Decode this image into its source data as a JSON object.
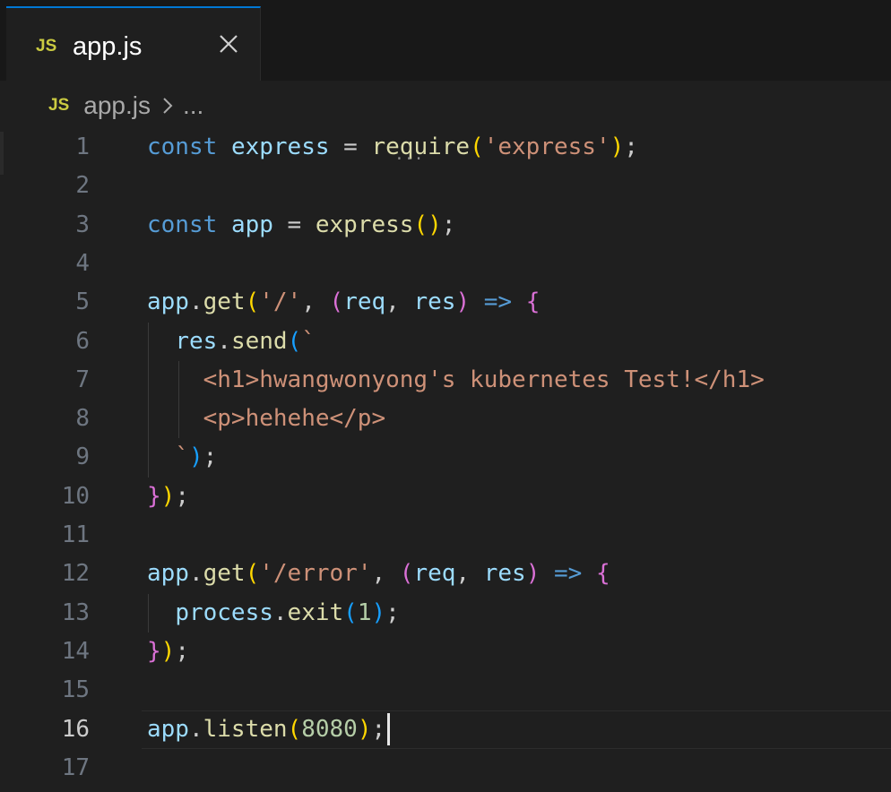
{
  "tab": {
    "badge": "JS",
    "title": "app.js"
  },
  "breadcrumb": {
    "badge": "JS",
    "file": "app.js",
    "more": "..."
  },
  "active_line": 16,
  "lines": [
    {
      "n": "1",
      "tokens": [
        [
          "k",
          "const"
        ],
        [
          "p",
          " "
        ],
        [
          "v",
          "express"
        ],
        [
          "p",
          " = "
        ],
        [
          "f",
          "require"
        ],
        [
          "b1",
          "("
        ],
        [
          "s",
          "'express'"
        ],
        [
          "b1",
          ")"
        ],
        [
          "p",
          ";"
        ]
      ]
    },
    {
      "n": "2",
      "tokens": []
    },
    {
      "n": "3",
      "tokens": [
        [
          "k",
          "const"
        ],
        [
          "p",
          " "
        ],
        [
          "v",
          "app"
        ],
        [
          "p",
          " = "
        ],
        [
          "f",
          "express"
        ],
        [
          "b1",
          "()"
        ],
        [
          "p",
          ";"
        ]
      ]
    },
    {
      "n": "4",
      "tokens": []
    },
    {
      "n": "5",
      "tokens": [
        [
          "v",
          "app"
        ],
        [
          "p",
          "."
        ],
        [
          "f",
          "get"
        ],
        [
          "b1",
          "("
        ],
        [
          "s",
          "'/'"
        ],
        [
          "p",
          ", "
        ],
        [
          "b2",
          "("
        ],
        [
          "pm",
          "req"
        ],
        [
          "p",
          ", "
        ],
        [
          "pm",
          "res"
        ],
        [
          "b2",
          ")"
        ],
        [
          "p",
          " "
        ],
        [
          "a",
          "=>"
        ],
        [
          "p",
          " "
        ],
        [
          "b2",
          "{"
        ]
      ]
    },
    {
      "n": "6",
      "tokens": [
        [
          "p",
          "  "
        ],
        [
          "v",
          "res"
        ],
        [
          "p",
          "."
        ],
        [
          "f",
          "send"
        ],
        [
          "b3",
          "("
        ],
        [
          "s",
          "`"
        ]
      ]
    },
    {
      "n": "7",
      "tokens": [
        [
          "p",
          "    "
        ],
        [
          "s",
          "<h1>hwangwonyong's kubernetes Test!</h1>"
        ]
      ]
    },
    {
      "n": "8",
      "tokens": [
        [
          "p",
          "    "
        ],
        [
          "s",
          "<p>hehehe</p>"
        ]
      ]
    },
    {
      "n": "9",
      "tokens": [
        [
          "p",
          "  "
        ],
        [
          "s",
          "`"
        ],
        [
          "b3",
          ")"
        ],
        [
          "p",
          ";"
        ]
      ]
    },
    {
      "n": "10",
      "tokens": [
        [
          "b2",
          "}"
        ],
        [
          "b1",
          ")"
        ],
        [
          "p",
          ";"
        ]
      ]
    },
    {
      "n": "11",
      "tokens": []
    },
    {
      "n": "12",
      "tokens": [
        [
          "v",
          "app"
        ],
        [
          "p",
          "."
        ],
        [
          "f",
          "get"
        ],
        [
          "b1",
          "("
        ],
        [
          "s",
          "'/error'"
        ],
        [
          "p",
          ", "
        ],
        [
          "b2",
          "("
        ],
        [
          "pm",
          "req"
        ],
        [
          "p",
          ", "
        ],
        [
          "pm",
          "res"
        ],
        [
          "b2",
          ")"
        ],
        [
          "p",
          " "
        ],
        [
          "a",
          "=>"
        ],
        [
          "p",
          " "
        ],
        [
          "b2",
          "{"
        ]
      ]
    },
    {
      "n": "13",
      "tokens": [
        [
          "p",
          "  "
        ],
        [
          "v",
          "process"
        ],
        [
          "p",
          "."
        ],
        [
          "f",
          "exit"
        ],
        [
          "b3",
          "("
        ],
        [
          "n",
          "1"
        ],
        [
          "b3",
          ")"
        ],
        [
          "p",
          ";"
        ]
      ]
    },
    {
      "n": "14",
      "tokens": [
        [
          "b2",
          "}"
        ],
        [
          "b1",
          ")"
        ],
        [
          "p",
          ";"
        ]
      ]
    },
    {
      "n": "15",
      "tokens": []
    },
    {
      "n": "16",
      "tokens": [
        [
          "v",
          "app"
        ],
        [
          "p",
          "."
        ],
        [
          "f",
          "listen"
        ],
        [
          "b1",
          "("
        ],
        [
          "n",
          "8080"
        ],
        [
          "b1",
          ")"
        ],
        [
          "p",
          ";"
        ]
      ]
    },
    {
      "n": "17",
      "tokens": []
    }
  ]
}
